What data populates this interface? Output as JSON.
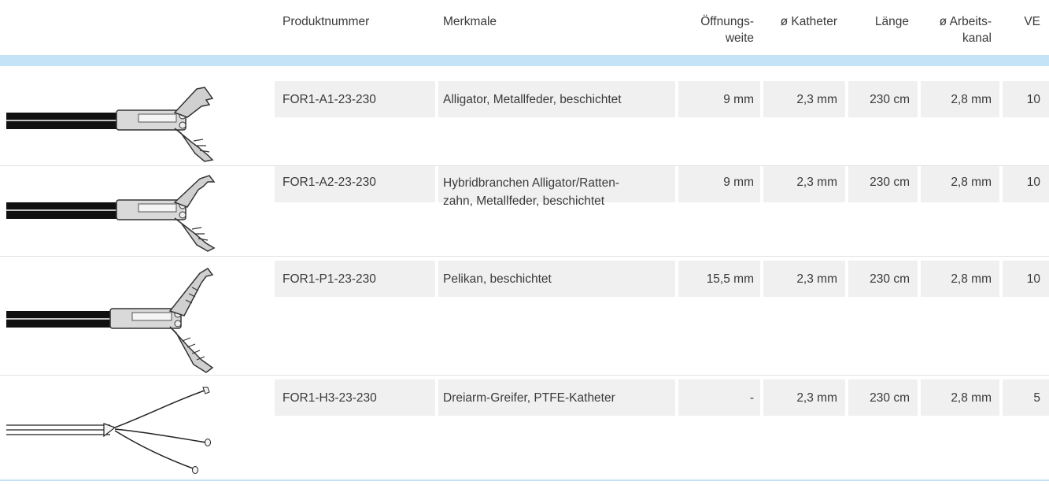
{
  "columns": {
    "product": "Produktnummer",
    "features": "Merkmale",
    "opening_1": "Öffnungs-",
    "opening_2": "weite",
    "catheter": "ø Katheter",
    "length": "Länge",
    "channel_1": "ø Arbeits-",
    "channel_2": "kanal",
    "ve": "VE"
  },
  "rows": [
    {
      "product": "FOR1-A1-23-230",
      "features_1": "Alligator, Metallfeder, beschichtet",
      "features_2": "",
      "opening": "9 mm",
      "catheter": "2,3 mm",
      "length": "230 cm",
      "channel": "2,8 mm",
      "ve": "10",
      "illustration": "alligator-forceps-icon"
    },
    {
      "product": "FOR1-A2-23-230",
      "features_1": "Hybridbranchen Alligator/Ratten-",
      "features_2": "zahn, Metallfeder, beschichtet",
      "opening": "9 mm",
      "catheter": "2,3 mm",
      "length": "230 cm",
      "channel": "2,8 mm",
      "ve": "10",
      "illustration": "hybrid-forceps-icon"
    },
    {
      "product": "FOR1-P1-23-230",
      "features_1": "Pelikan, beschichtet",
      "features_2": "",
      "opening": "15,5 mm",
      "catheter": "2,3 mm",
      "length": "230 cm",
      "channel": "2,8 mm",
      "ve": "10",
      "illustration": "pelican-forceps-icon"
    },
    {
      "product": "FOR1-H3-23-230",
      "features_1": "Dreiarm-Greifer, PTFE-Katheter",
      "features_2": "",
      "opening": "-",
      "catheter": "2,3 mm",
      "length": "230 cm",
      "channel": "2,8 mm",
      "ve": "5",
      "illustration": "three-prong-grasper-icon"
    }
  ],
  "colors": {
    "accent_bar": "#c5e3f6",
    "row_band": "#f0f0f0",
    "text": "#3a3a3a"
  }
}
